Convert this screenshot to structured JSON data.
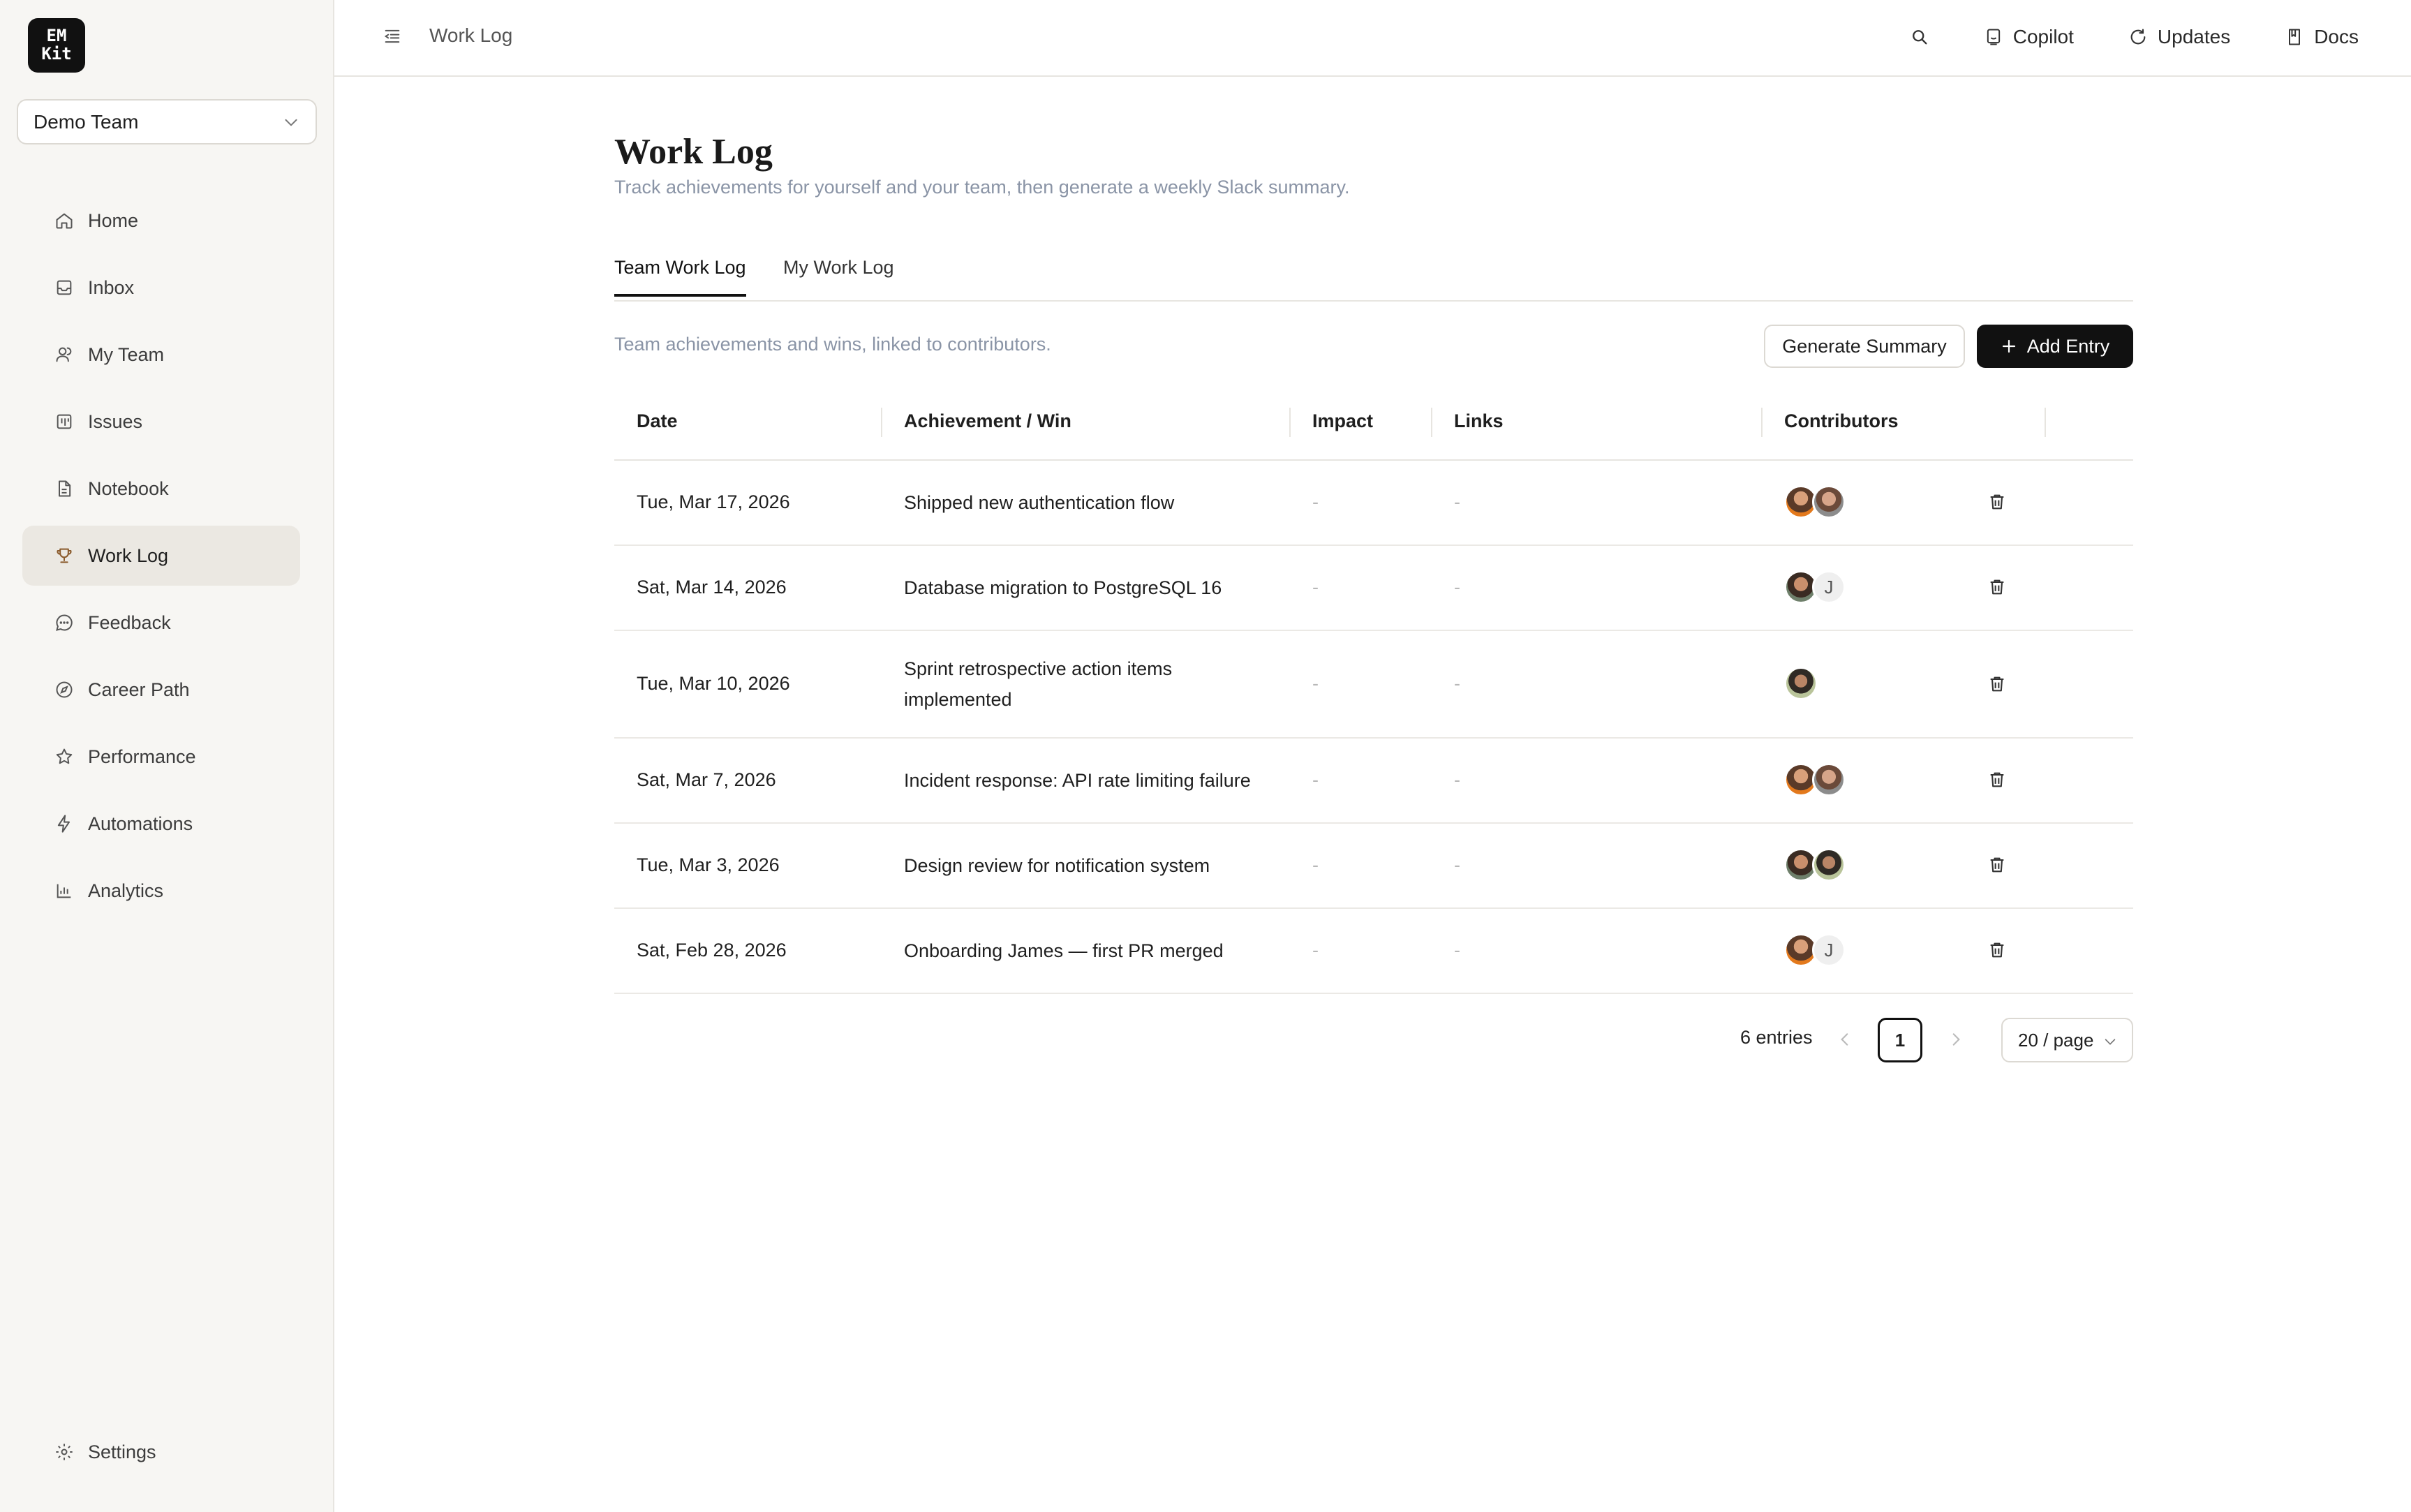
{
  "brand": {
    "logo_line1": "EM",
    "logo_line2": "Kit"
  },
  "team_selector": {
    "value": "Demo Team"
  },
  "sidebar": {
    "items": [
      {
        "label": "Home",
        "icon": "home-icon"
      },
      {
        "label": "Inbox",
        "icon": "inbox-icon"
      },
      {
        "label": "My Team",
        "icon": "team-icon"
      },
      {
        "label": "Issues",
        "icon": "board-icon"
      },
      {
        "label": "Notebook",
        "icon": "document-icon"
      },
      {
        "label": "Work Log",
        "icon": "trophy-icon",
        "active": true
      },
      {
        "label": "Feedback",
        "icon": "chat-icon"
      },
      {
        "label": "Career Path",
        "icon": "compass-icon"
      },
      {
        "label": "Performance",
        "icon": "star-icon"
      },
      {
        "label": "Automations",
        "icon": "bolt-icon"
      },
      {
        "label": "Analytics",
        "icon": "chart-icon"
      }
    ],
    "settings": {
      "label": "Settings",
      "icon": "gear-icon"
    }
  },
  "topbar": {
    "breadcrumb": "Work Log",
    "actions": [
      {
        "label": "Copilot",
        "icon": "copilot-icon"
      },
      {
        "label": "Updates",
        "icon": "refresh-icon"
      },
      {
        "label": "Docs",
        "icon": "book-icon"
      }
    ]
  },
  "page": {
    "title": "Work Log",
    "subtitle": "Track achievements for yourself and your team, then generate a weekly Slack summary.",
    "tabs": [
      {
        "label": "Team Work Log",
        "active": true
      },
      {
        "label": "My Work Log",
        "active": false
      }
    ],
    "description": "Team achievements and wins, linked to contributors.",
    "generate_button": "Generate Summary",
    "add_button": "Add Entry"
  },
  "table": {
    "columns": [
      "Date",
      "Achievement / Win",
      "Impact",
      "Links",
      "Contributors"
    ],
    "rows": [
      {
        "date": "Tue, Mar 17, 2026",
        "achievement": "Shipped new authentication flow",
        "impact": "-",
        "links": "-",
        "contributors": [
          "photo-a",
          "photo-b"
        ]
      },
      {
        "date": "Sat, Mar 14, 2026",
        "achievement": "Database migration to PostgreSQL 16",
        "impact": "-",
        "links": "-",
        "contributors": [
          "photo-c",
          "J"
        ]
      },
      {
        "date": "Tue, Mar 10, 2026",
        "achievement": "Sprint retrospective action items implemented",
        "impact": "-",
        "links": "-",
        "contributors": [
          "photo-d"
        ]
      },
      {
        "date": "Sat, Mar 7, 2026",
        "achievement": "Incident response: API rate limiting failure",
        "impact": "-",
        "links": "-",
        "contributors": [
          "photo-a",
          "photo-b"
        ]
      },
      {
        "date": "Tue, Mar 3, 2026",
        "achievement": "Design review for notification system",
        "impact": "-",
        "links": "-",
        "contributors": [
          "photo-c",
          "photo-d"
        ]
      },
      {
        "date": "Sat, Feb 28, 2026",
        "achievement": "Onboarding James — first PR merged",
        "impact": "-",
        "links": "-",
        "contributors": [
          "photo-a",
          "J"
        ]
      }
    ]
  },
  "pagination": {
    "entries": "6 entries",
    "current_page": "1",
    "page_size": "20 / page"
  },
  "colors": {
    "accent": "#111111",
    "muted_text": "#8a94a6",
    "sidebar_bg": "#f7f6f3",
    "active_nav_bg": "#ebe8e2"
  }
}
